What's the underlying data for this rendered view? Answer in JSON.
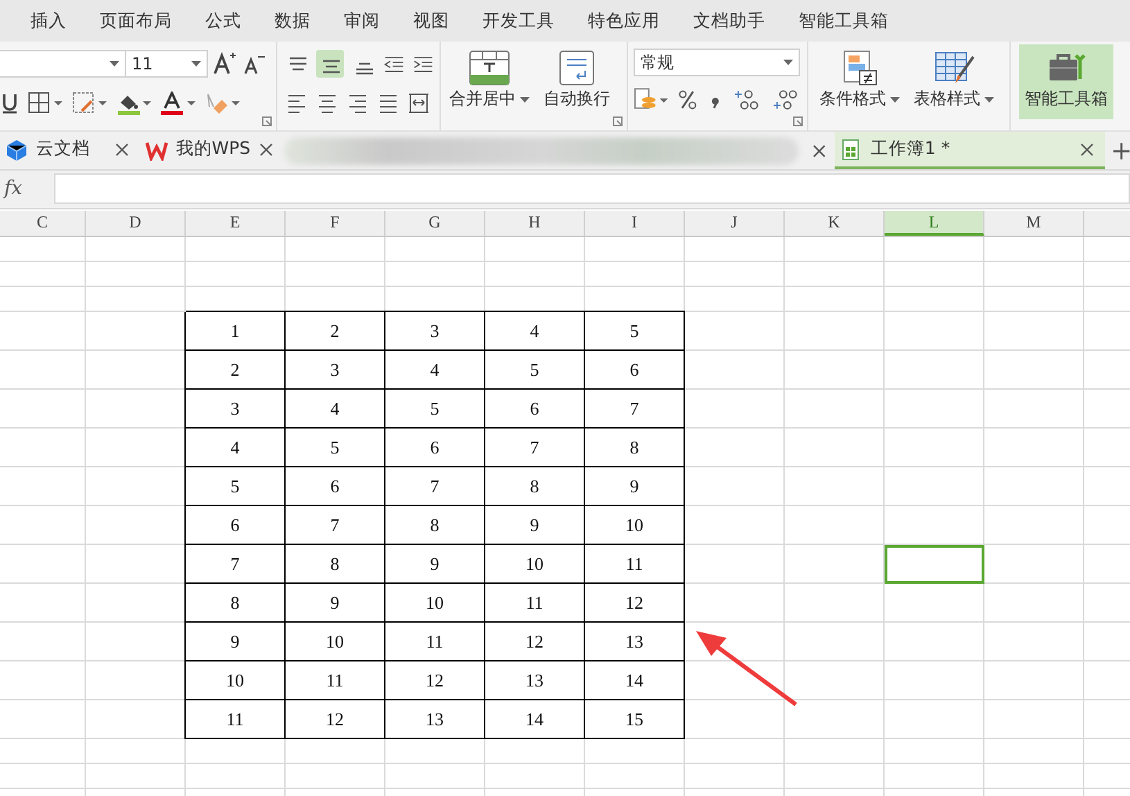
{
  "menu": [
    {
      "label": "插入"
    },
    {
      "label": "页面布局"
    },
    {
      "label": "公式"
    },
    {
      "label": "数据"
    },
    {
      "label": "审阅"
    },
    {
      "label": "视图"
    },
    {
      "label": "开发工具"
    },
    {
      "label": "特色应用"
    },
    {
      "label": "文档助手"
    },
    {
      "label": "智能工具箱"
    }
  ],
  "ribbon": {
    "font_size": "11",
    "number_format": "常规",
    "align_buttons": [
      {
        "selected": false
      },
      {
        "selected": true
      },
      {
        "selected": false
      }
    ],
    "tools": [
      {
        "label": "合并居中",
        "kind": "merge",
        "dropdown": true,
        "highlighted": false
      },
      {
        "label": "自动换行",
        "kind": "wrap",
        "dropdown": false,
        "highlighted": false
      },
      {
        "label": "条件格式",
        "kind": "conditional",
        "dropdown": true,
        "highlighted": false
      },
      {
        "label": "表格样式",
        "kind": "tablestyle",
        "dropdown": true,
        "highlighted": false
      },
      {
        "label": "智能工具箱",
        "kind": "toolbox",
        "dropdown": false,
        "highlighted": true
      }
    ]
  },
  "tabs": [
    {
      "kind": "cloud",
      "label": "云文档",
      "selected": false
    },
    {
      "kind": "wps",
      "label": "我的WPS",
      "selected": false
    },
    {
      "kind": "blurred",
      "selected": false
    },
    {
      "kind": "workbook",
      "label": "工作簿1 *",
      "selected": true
    }
  ],
  "formula_bar": {
    "label": "fx"
  },
  "sheet": {
    "columns": [
      {
        "label": "C",
        "selected": false
      },
      {
        "label": "D",
        "selected": false
      },
      {
        "label": "E",
        "selected": false
      },
      {
        "label": "F",
        "selected": false
      },
      {
        "label": "G",
        "selected": false
      },
      {
        "label": "H",
        "selected": false
      },
      {
        "label": "I",
        "selected": false
      },
      {
        "label": "J",
        "selected": false
      },
      {
        "label": "K",
        "selected": false
      },
      {
        "label": "L",
        "selected": true
      },
      {
        "label": "M",
        "selected": false
      }
    ],
    "rows": [
      {
        "cells": [
          "",
          "",
          "1",
          "2",
          "3",
          "4",
          "5"
        ],
        "selected": false
      },
      {
        "cells": [
          "",
          "",
          "2",
          "3",
          "4",
          "5",
          "6"
        ],
        "selected": false
      },
      {
        "cells": [
          "",
          "",
          "3",
          "4",
          "5",
          "6",
          "7"
        ],
        "selected": false
      },
      {
        "cells": [
          "",
          "",
          "4",
          "5",
          "6",
          "7",
          "8"
        ],
        "selected": false
      },
      {
        "cells": [
          "",
          "",
          "5",
          "6",
          "7",
          "8",
          "9"
        ],
        "selected": false
      },
      {
        "cells": [
          "",
          "",
          "6",
          "7",
          "8",
          "9",
          "10"
        ],
        "selected": false
      },
      {
        "cells": [
          "",
          "",
          "7",
          "8",
          "9",
          "10",
          "11"
        ],
        "selected": true
      },
      {
        "cells": [
          "",
          "",
          "8",
          "9",
          "10",
          "11",
          "12"
        ],
        "selected": false
      },
      {
        "cells": [
          "",
          "",
          "9",
          "10",
          "11",
          "12",
          "13"
        ],
        "selected": false
      },
      {
        "cells": [
          "",
          "",
          "10",
          "11",
          "12",
          "13",
          "14"
        ],
        "selected": false
      },
      {
        "cells": [
          "",
          "",
          "11",
          "12",
          "13",
          "14",
          "15"
        ],
        "selected": false
      }
    ]
  }
}
